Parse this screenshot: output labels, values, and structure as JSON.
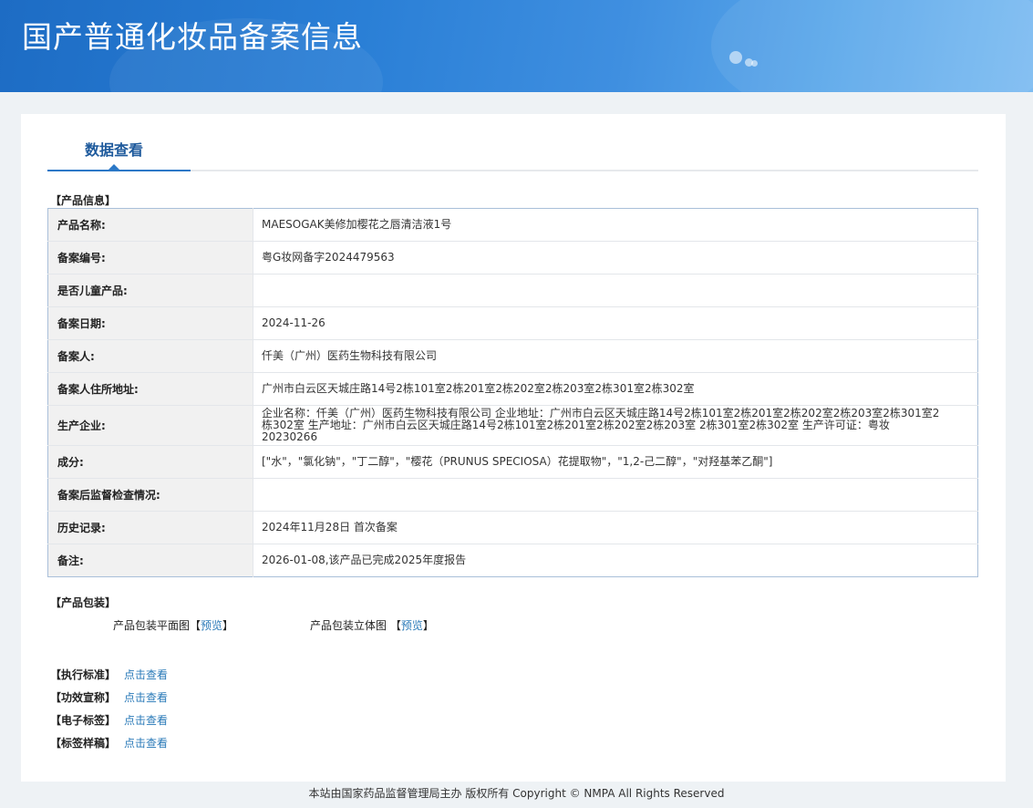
{
  "header": {
    "title": "国产普通化妆品备案信息"
  },
  "tab": {
    "label": "数据查看"
  },
  "product_info": {
    "section_title": "【产品信息】",
    "rows": [
      {
        "key": "产品名称:",
        "value": "MAESOGAK美修加樱花之唇清洁液1号"
      },
      {
        "key": "备案编号:",
        "value": "粤G妆网备字2024479563"
      },
      {
        "key": "是否儿童产品:",
        "value": ""
      },
      {
        "key": "备案日期:",
        "value": "2024-11-26"
      },
      {
        "key": "备案人:",
        "value": "仟美（广州）医药生物科技有限公司"
      },
      {
        "key": "备案人住所地址:",
        "value": "广州市白云区天城庄路14号2栋101室2栋201室2栋202室2栋203室2栋301室2栋302室"
      },
      {
        "key": "生产企业:",
        "value": "企业名称：仟美（广州）医药生物科技有限公司 企业地址：广州市白云区天城庄路14号2栋101室2栋201室2栋202室2栋203室2栋301室2栋302室 生产地址：广州市白云区天城庄路14号2栋101室2栋201室2栋202室2栋203室 2栋301室2栋302室 生产许可证：粤妆20230266"
      },
      {
        "key": "成分:",
        "value": "[\"水\"，\"氯化钠\"，\"丁二醇\"，\"樱花（PRUNUS SPECIOSA）花提取物\"，\"1,2-己二醇\"，\"对羟基苯乙酮\"]"
      },
      {
        "key": "备案后监督检查情况:",
        "value": ""
      },
      {
        "key": "历史记录:",
        "value": "2024年11月28日 首次备案"
      },
      {
        "key": "备注:",
        "value": "2026-01-08,该产品已完成2025年度报告"
      }
    ]
  },
  "packaging": {
    "section_title": "【产品包装】",
    "flat_label": "产品包装平面图",
    "flat_preview": "预览",
    "solid_label": "产品包装立体图",
    "solid_preview": "预览",
    "bracket_open": "【",
    "bracket_close": "】"
  },
  "standards": [
    {
      "key": "【执行标准】",
      "link": "点击查看"
    },
    {
      "key": "【功效宣称】",
      "link": "点击查看"
    },
    {
      "key": "【电子标签】",
      "link": "点击查看"
    },
    {
      "key": "【标签样稿】",
      "link": "点击查看"
    }
  ],
  "footer": {
    "text": "本站由国家药品监督管理局主办 版权所有 Copyright © NMPA All Rights Reserved"
  }
}
